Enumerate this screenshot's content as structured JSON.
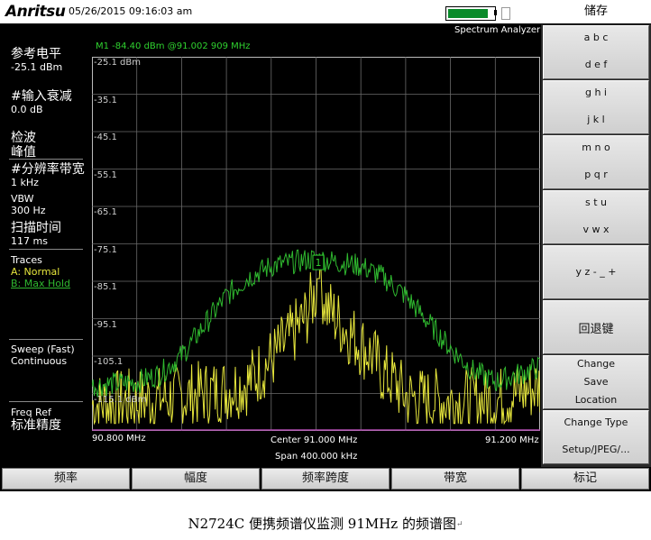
{
  "header": {
    "logo": "Anritsu",
    "datetime": "05/26/2015 09:16:03 am",
    "mode": "Spectrum Analyzer",
    "battery_level": 0.92
  },
  "marker": {
    "readout": "M1 -84.40 dBm @91.002 909 MHz",
    "label": "1"
  },
  "left_panel": {
    "ref_level_label": "参考电平",
    "ref_level_value": "-25.1 dBm",
    "atten_label": "#输入衰减",
    "atten_value": "0.0 dB",
    "detect_label": "检波",
    "detect_value": "峰值",
    "rbw_label": "#分辨率带宽",
    "rbw_value": "1 kHz",
    "vbw_label": "VBW",
    "vbw_value": "300 Hz",
    "sweep_time_label": "扫描时间",
    "sweep_time_value": "117 ms",
    "traces_label": "Traces",
    "trace_a": "A: Normal",
    "trace_b": "B: Max Hold",
    "sweep_label": "Sweep (Fast)",
    "sweep_value": "Continuous",
    "freq_ref_label": "Freq Ref",
    "freq_ref_value": "标准精度"
  },
  "plot": {
    "y_ticks": [
      "-25.1 dBm",
      "-35.1",
      "-45.1",
      "-55.1",
      "-65.1",
      "-75.1",
      "-85.1",
      "-95.1",
      "-105.1",
      "-115.1 dBm"
    ],
    "start": "90.800 MHz",
    "center": "Center 91.000 MHz",
    "stop": "91.200 MHz",
    "span": "Span 400.000 kHz"
  },
  "chart_data": {
    "type": "line",
    "xlabel": "",
    "ylabel": "",
    "xlim": [
      90.8,
      91.2
    ],
    "ylim": [
      -125.1,
      -25.1
    ],
    "grid": true,
    "series": [
      {
        "name": "A: Normal",
        "color": "#e6e63c",
        "x": [
          90.8,
          90.84,
          90.88,
          90.9,
          90.92,
          90.94,
          90.96,
          90.975,
          90.99,
          91.0,
          91.002,
          91.01,
          91.02,
          91.03,
          91.04,
          91.05,
          91.06,
          91.07,
          91.08,
          91.1,
          91.12,
          91.16,
          91.2
        ],
        "y": [
          -118,
          -117,
          -116,
          -115,
          -114,
          -112,
          -106,
          -101,
          -95,
          -88,
          -84.4,
          -92,
          -96,
          -99,
          -102,
          -105,
          -110,
          -112,
          -116,
          -117,
          -117,
          -117,
          -113
        ]
      },
      {
        "name": "B: Max Hold",
        "color": "#2fb82f",
        "x": [
          90.8,
          90.84,
          90.86,
          90.88,
          90.9,
          90.92,
          90.94,
          90.96,
          90.98,
          91.0,
          91.02,
          91.04,
          91.06,
          91.08,
          91.1,
          91.12,
          91.14,
          91.16,
          91.2
        ],
        "y": [
          -113,
          -112,
          -110,
          -105,
          -97,
          -89,
          -84,
          -81,
          -80,
          -79,
          -80,
          -81,
          -84,
          -89,
          -96,
          -103,
          -109,
          -112,
          -108
        ]
      }
    ]
  },
  "softkeys": {
    "title": "储存",
    "keys": [
      {
        "line1": "a b c",
        "line2": "d e f"
      },
      {
        "line1": "g h i",
        "line2": "j k l"
      },
      {
        "line1": "m n o",
        "line2": "p q r"
      },
      {
        "line1": "s t u",
        "line2": "v w x"
      },
      {
        "line1": "y z - _ +",
        "line2": ""
      },
      {
        "line1": "回退键",
        "line2": ""
      },
      {
        "line1": "Change",
        "line2": "Save",
        "line3": "Location"
      },
      {
        "line1": "Change Type",
        "line2": "Setup/JPEG/..."
      }
    ]
  },
  "bottom_keys": [
    "频率",
    "幅度",
    "频率跨度",
    "带宽",
    "标记"
  ],
  "caption": "N2724C 便携频谱仪监测 91MHz 的频谱图",
  "caption_mark": "↵"
}
